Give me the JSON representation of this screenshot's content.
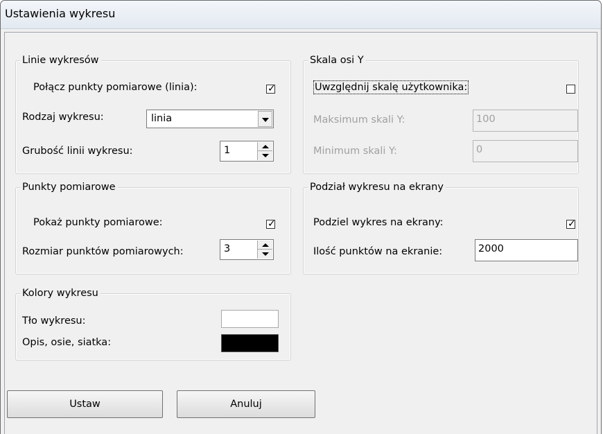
{
  "window": {
    "title": "Ustawienia wykresu"
  },
  "lines_group": {
    "legend": "Linie wykresów",
    "connect_points_label": "Połącz punkty pomiarowe (linia):",
    "connect_points_checked": true,
    "chart_type_label": "Rodzaj wykresu:",
    "chart_type_value": "linia",
    "line_width_label": "Grubość linii wykresu:",
    "line_width_value": "1"
  },
  "y_scale_group": {
    "legend": "Skala osi Y",
    "user_scale_label": "Uwzględnij skalę użytkownika:",
    "user_scale_checked": false,
    "max_label": "Maksimum skali Y:",
    "max_value": "100",
    "min_label": "Minimum skali Y:",
    "min_value": "0"
  },
  "points_group": {
    "legend": "Punkty pomiarowe",
    "show_points_label": "Pokaż punkty pomiarowe:",
    "show_points_checked": true,
    "point_size_label": "Rozmiar punktów pomiarowych:",
    "point_size_value": "3"
  },
  "split_group": {
    "legend": "Podział wykresu na ekrany",
    "split_label": "Podziel wykres na ekrany:",
    "split_checked": true,
    "points_per_screen_label": "Ilość punktów na ekranie:",
    "points_per_screen_value": "2000"
  },
  "colors_group": {
    "legend": "Kolory wykresu",
    "background_label": "Tło wykresu:",
    "background_color": "#ffffff",
    "axes_label": "Opis, osie, siatka:",
    "axes_color": "#000000"
  },
  "buttons": {
    "ok_label": "Ustaw",
    "cancel_label": "Anuluj"
  }
}
